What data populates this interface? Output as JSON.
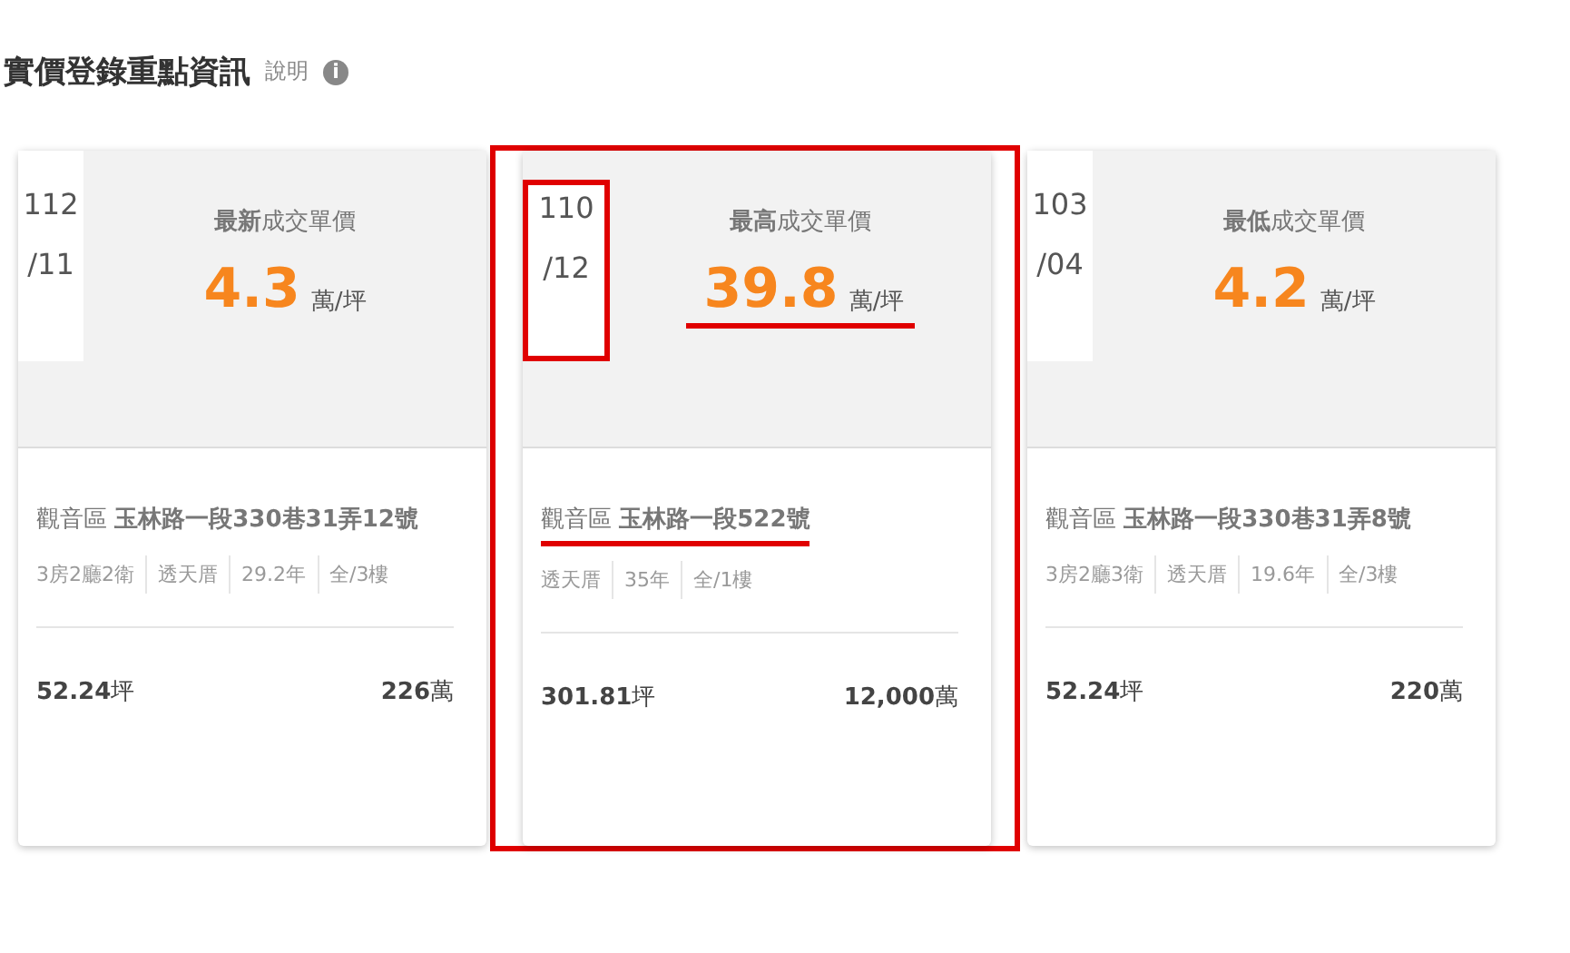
{
  "header": {
    "title": "實價登錄重點資訊",
    "help_label": "說明",
    "help_icon": "i"
  },
  "cards": [
    {
      "date_year": "112",
      "date_month": "/11",
      "label": "**最新**成交單價",
      "price": "4.3",
      "price_unit": "萬/坪",
      "address": "觀音區 **玉林路一段330巷31弄12號**",
      "specs": [
        "3房2廳2衛",
        "透天厝",
        "29.2年",
        "全/3樓"
      ],
      "area": "**52.24**坪",
      "total": "**226**萬",
      "framed": false,
      "date_circled": false,
      "price_underlined": false,
      "address_underlined": false
    },
    {
      "date_year": "110",
      "date_month": "/12",
      "label": "**最高**成交單價",
      "price": "39.8",
      "price_unit": "萬/坪",
      "address": "觀音區 **玉林路一段522號**",
      "specs": [
        "透天厝",
        "35年",
        "全/1樓"
      ],
      "area": "**301.81**坪",
      "total": "**12,000**萬",
      "framed": true,
      "date_circled": true,
      "price_underlined": true,
      "address_underlined": true
    },
    {
      "date_year": "103",
      "date_month": "/04",
      "label": "**最低**成交單價",
      "price": "4.2",
      "price_unit": "萬/坪",
      "address": "觀音區 **玉林路一段330巷31弄8號**",
      "specs": [
        "3房2廳3衛",
        "透天厝",
        "19.6年",
        "全/3樓"
      ],
      "area": "**52.24**坪",
      "total": "**220**萬",
      "framed": false,
      "date_circled": false,
      "price_underlined": false,
      "address_underlined": false
    }
  ]
}
